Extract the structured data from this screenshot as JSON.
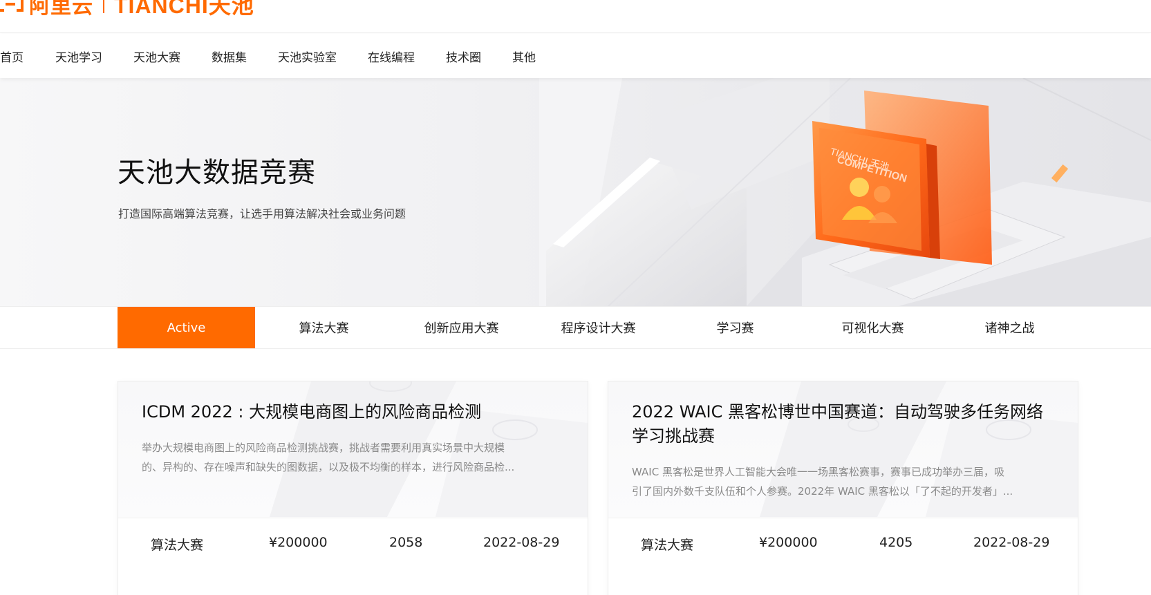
{
  "brand": {
    "aliyun": "阿里云",
    "tianchi": "TIANCHI天池",
    "color": "#ff6a00"
  },
  "nav": [
    "首页",
    "天池学习",
    "天池大赛",
    "数据集",
    "天池实验室",
    "在线编程",
    "技术圈",
    "其他"
  ],
  "hero": {
    "title": "天池大数据竞赛",
    "subtitle": "打造国际高端算法竞赛，让选手用算法解决社会或业务问题",
    "badge_text": "COMPETITION",
    "badge_brand": "TIANCHI 天池"
  },
  "tabs": [
    "Active",
    "算法大赛",
    "创新应用大赛",
    "程序设计大赛",
    "学习赛",
    "可视化大赛",
    "诸神之战"
  ],
  "active_tab": "Active",
  "cards": [
    {
      "title": "ICDM 2022 : 大规模电商图上的风险商品检测",
      "desc_line1": "举办大规模电商图上的风险商品检测挑战赛，挑战者需要利用真实场景中大规模",
      "desc_line2": "的、异构的、存在噪声和缺失的图数据，以及极不均衡的样本，进行风险商品检...",
      "category": "算法大赛",
      "prize": "¥200000",
      "teams": "2058",
      "deadline": "2022-08-29"
    },
    {
      "title": "2022 WAIC 黑客松博世中国赛道：自动驾驶多任务网络学习挑战赛",
      "desc_line1": "WAIC 黑客松是世界人工智能大会唯一一场黑客松赛事，赛事已成功举办三届，吸",
      "desc_line2": "引了国内外数千支队伍和个人参赛。2022年 WAIC 黑客松以「了不起的开发者」...",
      "category": "算法大赛",
      "prize": "¥200000",
      "teams": "4205",
      "deadline": "2022-08-29"
    }
  ]
}
